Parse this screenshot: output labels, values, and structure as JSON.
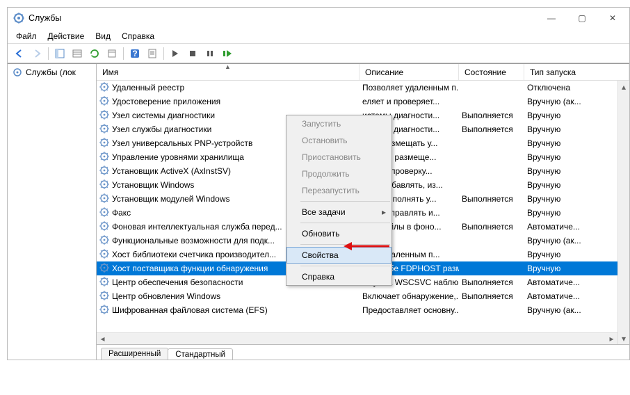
{
  "window": {
    "title": "Службы"
  },
  "controls": {
    "min": "—",
    "max": "▢",
    "close": "✕"
  },
  "menu": {
    "file": "Файл",
    "action": "Действие",
    "view": "Вид",
    "help": "Справка"
  },
  "tree": {
    "root": "Службы (лок"
  },
  "columns": {
    "name": "Имя",
    "description": "Описание",
    "state": "Состояние",
    "start": "Тип запуска"
  },
  "rows": [
    {
      "name": "Удаленный реестр",
      "desc": "Позволяет удаленным п...",
      "state": "",
      "start": "Отключена"
    },
    {
      "name": "Удостоверение приложения",
      "desc": "еляет и проверяет...",
      "state": "",
      "start": "Вручную (ак..."
    },
    {
      "name": "Узел системы диагностики",
      "desc": "истемы диагности...",
      "state": "Выполняется",
      "start": "Вручную"
    },
    {
      "name": "Узел службы диагностики",
      "desc": "истемы диагности...",
      "state": "Выполняется",
      "start": "Вручную"
    },
    {
      "name": "Узел универсальных PNP-устройств",
      "desc": "ляет размещать у...",
      "state": "",
      "start": "Вручную"
    },
    {
      "name": "Управление уровнями хранилища",
      "desc": "изирует размеще...",
      "state": "",
      "start": "Вручную"
    },
    {
      "name": "Установщик ActiveX (AxInstSV)",
      "desc": "чивает проверку...",
      "state": "",
      "start": "Вручную"
    },
    {
      "name": "Установщик Windows",
      "desc": "ляет добавлять, из...",
      "state": "",
      "start": "Вручную"
    },
    {
      "name": "Установщик модулей Windows",
      "desc": "ляет выполнять у...",
      "state": "Выполняется",
      "start": "Вручную"
    },
    {
      "name": "Факс",
      "desc": "ляет отправлять и...",
      "state": "",
      "start": "Вручную"
    },
    {
      "name": "Фоновая интеллектуальная служба перед...",
      "desc": "ает файлы в фоно...",
      "state": "Выполняется",
      "start": "Автоматиче..."
    },
    {
      "name": "Функциональные возможности для подк...",
      "desc": "",
      "state": "",
      "start": "Вручную (ак..."
    },
    {
      "name": "Хост библиотеки счетчика производител...",
      "desc": "ляет удаленным п...",
      "state": "",
      "start": "Вручную"
    },
    {
      "name": "Хост поставщика функции обнаружения",
      "desc": "В службе FDPHOST разм...",
      "state": "",
      "start": "Вручную"
    },
    {
      "name": "Центр обеспечения безопасности",
      "desc": "Служба WSCSVC наблю...",
      "state": "Выполняется",
      "start": "Автоматиче..."
    },
    {
      "name": "Центр обновления Windows",
      "desc": "Включает обнаружение,...",
      "state": "Выполняется",
      "start": "Автоматиче..."
    },
    {
      "name": "Шифрованная файловая система (EFS)",
      "desc": "Предоставляет основну...",
      "state": "",
      "start": "Вручную (ак..."
    }
  ],
  "selected_index": 13,
  "context_menu": {
    "start": "Запустить",
    "stop": "Остановить",
    "pause": "Приостановить",
    "resume": "Продолжить",
    "restart": "Перезапустить",
    "alltasks": "Все задачи",
    "refresh": "Обновить",
    "properties": "Свойства",
    "help": "Справка"
  },
  "tabs": {
    "extended": "Расширенный",
    "standard": "Стандартный"
  }
}
